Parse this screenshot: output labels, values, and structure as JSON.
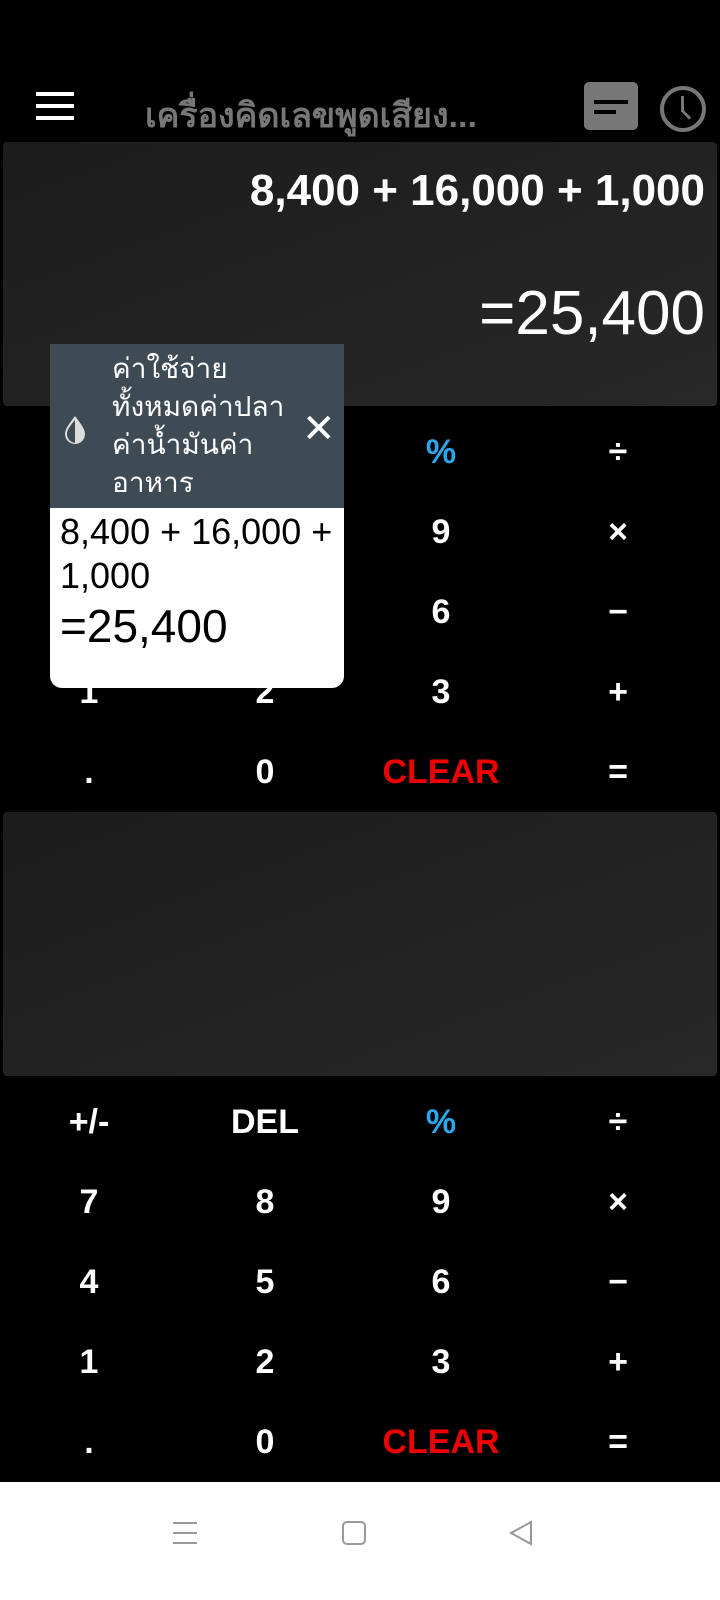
{
  "header": {
    "title": "เครื่องคิดเลขพูดเสียง...",
    "icons": [
      "menu-icon",
      "calendar-icon",
      "clock-icon"
    ]
  },
  "display_top": {
    "expression": "8,400 + 16,000 + 1,000",
    "result": "=25,400"
  },
  "display_bottom": {
    "expression": "",
    "result": ""
  },
  "keypad_rows": [
    [
      "+/-",
      "DEL",
      "%",
      "÷"
    ],
    [
      "7",
      "8",
      "9",
      "×"
    ],
    [
      "4",
      "5",
      "6",
      "−"
    ],
    [
      "1",
      "2",
      "3",
      "+"
    ],
    [
      ".",
      "0",
      "CLEAR",
      "="
    ]
  ],
  "popup": {
    "title": "ค่าใช้จ่ายทั้งหมดค่าปลาค่าน้ำมันค่าอาหาร",
    "expression": "8,400 + 16,000 + 1,000",
    "result": "=25,400"
  },
  "colors": {
    "percent": "#2aa8ee",
    "clear": "#ee0000",
    "popup_header": "#3e4a54",
    "title": "#777777"
  }
}
